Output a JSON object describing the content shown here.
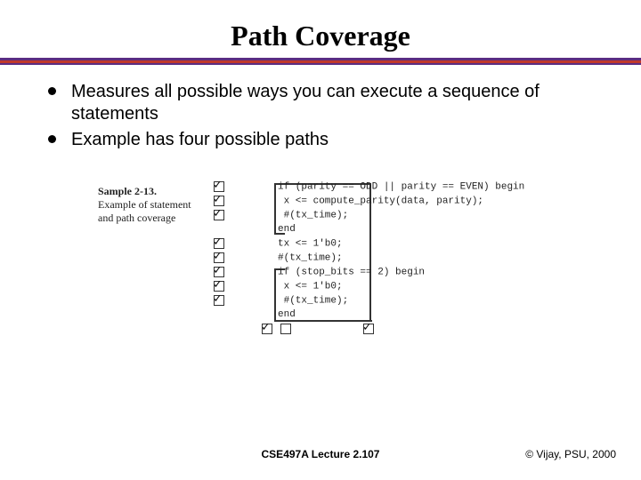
{
  "title": "Path Coverage",
  "bullets": [
    "Measures all possible ways you can execute a sequence of statements",
    "Example has four possible paths"
  ],
  "figure": {
    "caption_title": "Sample 2-13.",
    "caption_body": "Example of statement and path coverage",
    "code_lines": [
      "if (parity == ODD || parity == EVEN) begin",
      "   x <= compute_parity(data, parity);",
      "   #(tx_time);",
      "end",
      "tx <= 1'b0;",
      "#(tx_time);",
      "if (stop_bits == 2) begin",
      "   x <= 1'b0;",
      "   #(tx_time);",
      "end"
    ]
  },
  "footer": {
    "center": "CSE497A Lecture 2.107",
    "right": "© Vijay, PSU, 2000"
  }
}
